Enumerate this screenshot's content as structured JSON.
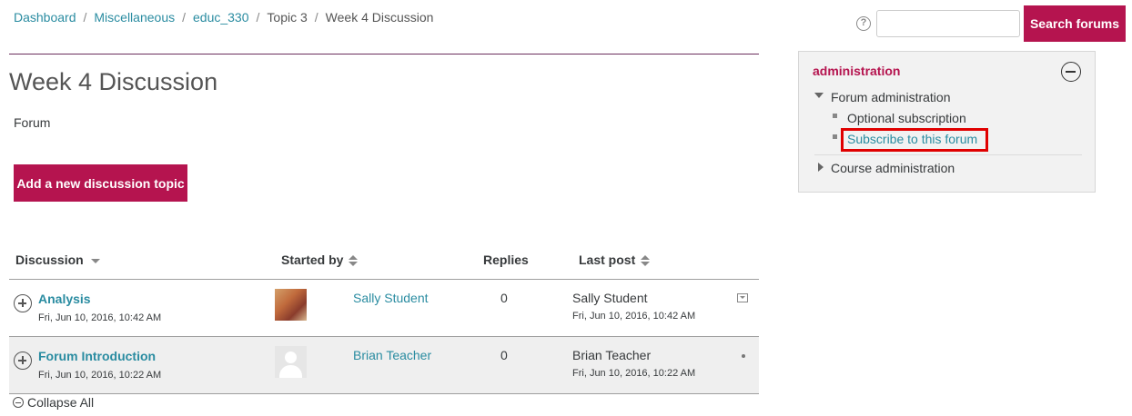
{
  "breadcrumb": {
    "items": [
      "Dashboard",
      "Miscellaneous",
      "educ_330",
      "Topic 3",
      "Week 4 Discussion"
    ],
    "separator": "/"
  },
  "search": {
    "help_icon": "question-circle-icon",
    "placeholder": "",
    "value": "",
    "button_label": "Search forums"
  },
  "page": {
    "title": "Week 4 Discussion",
    "subtitle": "Forum",
    "add_topic_label": "Add a new discussion topic"
  },
  "table": {
    "headers": {
      "discussion": "Discussion",
      "started_by": "Started by",
      "replies": "Replies",
      "last_post": "Last post"
    },
    "rows": [
      {
        "title": "Analysis",
        "date": "Fri, Jun 10, 2016, 10:42 AM",
        "starter": "Sally Student",
        "replies": "0",
        "last_post_by": "Sally Student",
        "last_post_date": "Fri, Jun 10, 2016, 10:42 AM"
      },
      {
        "title": "Forum Introduction",
        "date": "Fri, Jun 10, 2016, 10:22 AM",
        "starter": "Brian Teacher",
        "replies": "0",
        "last_post_by": "Brian Teacher",
        "last_post_date": "Fri, Jun 10, 2016, 10:22 AM"
      }
    ],
    "collapse_all_label": "Collapse All"
  },
  "admin": {
    "title": "administration",
    "forum_admin_label": "Forum administration",
    "items": [
      "Optional subscription",
      "Subscribe to this forum"
    ],
    "course_admin_label": "Course administration"
  },
  "colors": {
    "brand": "#b5144f",
    "link": "#2a8ca1",
    "highlight": "#e00000",
    "row_alt": "#efefef"
  }
}
